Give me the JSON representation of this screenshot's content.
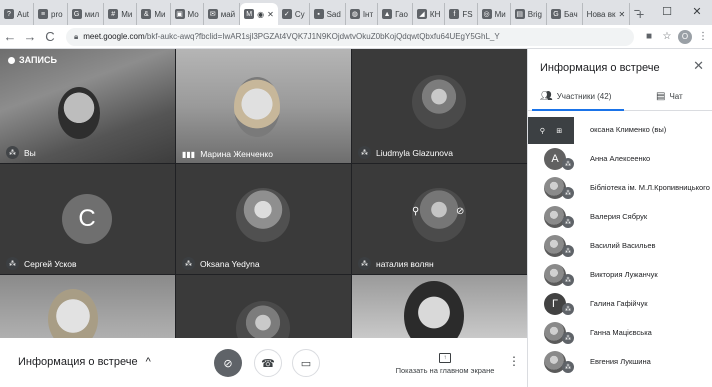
{
  "browser": {
    "tabs": [
      {
        "label": "Aut",
        "icon": "help-icon"
      },
      {
        "label": "pro",
        "icon": "bars-icon"
      },
      {
        "label": "мил",
        "icon": "google-icon"
      },
      {
        "label": "Ми",
        "icon": "app-icon"
      },
      {
        "label": "Ми",
        "icon": "app-icon"
      },
      {
        "label": "Мо",
        "icon": "app-icon"
      },
      {
        "label": "май",
        "icon": "mail-icon"
      },
      {
        "label": "",
        "icon": "meet-icon",
        "active": true
      },
      {
        "label": "Су",
        "icon": "app-icon"
      },
      {
        "label": "Sad",
        "icon": "app-icon"
      },
      {
        "label": "Інт",
        "icon": "app-icon"
      },
      {
        "label": "Гао",
        "icon": "app-icon"
      },
      {
        "label": "КН",
        "icon": "app-icon"
      },
      {
        "label": "FS",
        "icon": "app-icon"
      },
      {
        "label": "Ми",
        "icon": "app-icon"
      },
      {
        "label": "Brig",
        "icon": "app-icon"
      },
      {
        "label": "Бач",
        "icon": "google-icon"
      },
      {
        "label": "Нова вк",
        "icon": "app-icon"
      }
    ],
    "new_tab": "+",
    "window_controls": [
      "−",
      "☐",
      "✕"
    ],
    "back": "←",
    "forward": "→",
    "reload": "C",
    "url_host": "meet.google.com",
    "url_path": "/bkf-aukc-awq?fbclid=IwAR1sjl3PGZAt4VQK7J1N9KOjdwtvOkuZ0bKojQdqwtQbxfu64UEgY5GhL_Y",
    "toolbar_icons": [
      "■",
      "☆",
      "⋮"
    ],
    "profile_initial": "О"
  },
  "meet": {
    "recording": "ЗАПИСЬ",
    "tiles": [
      {
        "name": "Вы",
        "kind": "video"
      },
      {
        "name": "Марина Женченко",
        "kind": "video"
      },
      {
        "name": "Liudmyla Glazunova",
        "kind": "photo"
      },
      {
        "name": "Сергей Усков",
        "kind": "letter",
        "initial": "С",
        "color": "#757575"
      },
      {
        "name": "Oksana Yedyna",
        "kind": "photo"
      },
      {
        "name": "наталия волян",
        "kind": "photo"
      },
      {
        "name": "",
        "kind": "video"
      },
      {
        "name": "",
        "kind": "photo"
      },
      {
        "name": "",
        "kind": "video"
      }
    ],
    "bottom": {
      "meeting_info": "Информация о встрече",
      "chevron": "^",
      "present_label": "Показать на главном экране"
    }
  },
  "panel": {
    "title": "Информация о встрече",
    "close": "✕",
    "tab_people": "Участники (42)",
    "tab_chat": "Чат",
    "participants": [
      {
        "name": "оксана Клименко (вы)",
        "avatar": "self"
      },
      {
        "name": "Анна Алексеенко",
        "avatar": "letter",
        "initial": "А"
      },
      {
        "name": "Бібліотека ім. М.Л.Кропивницького",
        "avatar": "photo"
      },
      {
        "name": "Валерия Сябрук",
        "avatar": "photo"
      },
      {
        "name": "Василий Васильев",
        "avatar": "photo"
      },
      {
        "name": "Виктория Лужанчук",
        "avatar": "photo"
      },
      {
        "name": "Галина Гафійчук",
        "avatar": "letter",
        "initial": "Г"
      },
      {
        "name": "Ганна Мацієвська",
        "avatar": "photo"
      },
      {
        "name": "Евгения Лукшина",
        "avatar": "photo"
      }
    ]
  }
}
